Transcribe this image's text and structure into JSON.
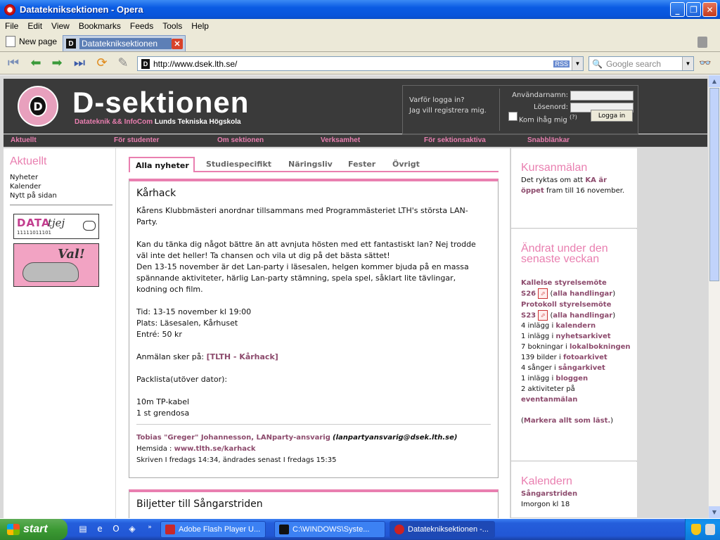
{
  "window": {
    "title": "Datateknik­sektionen - Opera"
  },
  "menubar": [
    "File",
    "Edit",
    "View",
    "Bookmarks",
    "Feeds",
    "Tools",
    "Help"
  ],
  "tabs": {
    "new_page": "New page",
    "active": "Datatekniksektionen"
  },
  "address": {
    "url": "http://www.dsek.lth.se/",
    "rss": "RSS",
    "search_placeholder": "Google search"
  },
  "header": {
    "logo_text": "D",
    "title": "D-sektionen",
    "sub_pink": "Datateknik && InfoCom",
    "sub_white": "Lunds Tekniska Högskola",
    "login": {
      "why": "Varför logga in?",
      "register": "Jag vill registrera mig.",
      "username_label": "Användarnamn:",
      "password_label": "Lösenord:",
      "remember": "Kom ihåg mig",
      "help": "(?)",
      "button": "Logga in"
    }
  },
  "topnav": [
    "Aktuellt",
    "För studenter",
    "Om sektionen",
    "Verksamhet",
    "För sektionsaktiva",
    "Snabblänkar"
  ],
  "left": {
    "title": "Aktuellt",
    "links": [
      "Nyheter",
      "Kalender",
      "Nytt på sidan"
    ],
    "banner1": {
      "data": "DATA",
      "tjej": "tjej",
      "binary": "11111011101"
    },
    "banner2": {
      "text": "Val!"
    }
  },
  "subtabs": [
    "Alla nyheter",
    "Studiespecifikt",
    "Näringsliv",
    "Fester",
    "Övrigt"
  ],
  "article1": {
    "title": "Kårhack",
    "p1": "Kårens Klubbmästeri anordnar tillsammans med Programmästeriet LTH's största LAN-Party.",
    "p2": "Kan du tänka dig något bättre än att avnjuta hösten med ett fantastiskt lan? Nej trodde väl inte det heller! Ta chansen och vila ut dig på det bästa sättet!",
    "p3": "Den 13-15 november är det Lan-party i läsesalen, helgen kommer bjuda på en massa spännande aktiviteter, härlig Lan-party stämning, spela spel, såklart lite tävlingar, kodning och film.",
    "tid": "Tid: 13-15 november kl 19:00",
    "plats": "Plats: Läsesalen, Kårhuset",
    "entre": "Entré: 50 kr",
    "anmalan_prefix": "Anmälan sker på:",
    "anmalan_link": "[TLTH - Kårhack]",
    "packlista": "Packlista(utöver dator):",
    "item1": "10m TP-kabel",
    "item2": "1 st grendosa",
    "author": "Tobias \"Greger\" Johannesson, LANparty-ansvarig",
    "email": "(lanpartyansvarig@dsek.lth.se)",
    "hemsida_label": "Hemsida :",
    "hemsida": "www.tlth.se/karhack",
    "written": "Skriven I fredags 14:34, ändrades senast I fredags 15:35"
  },
  "article2": {
    "title": "Biljetter till Sångarstriden"
  },
  "right": {
    "box1": {
      "title": "Kursanmälan",
      "t1": "Det ryktas om att",
      "link": "KA är öppet",
      "t2": "fram till 16 november."
    },
    "box2": {
      "title": "Ändrat under den senaste veckan",
      "l1": "Kallelse styrelsemöte",
      "s26": "S26",
      "alla": "alla handlingar",
      "l2": "Protokoll styrelsemöte",
      "s23": "S23",
      "r1a": "4 inlägg i",
      "r1b": "kalendern",
      "r2a": "1 inlägg i",
      "r2b": "nyhetsarkivet",
      "r3a": "7 bokningar i",
      "r3b": "lokalbokningen",
      "r4a": "139 bilder i",
      "r4b": "fotoarkivet",
      "r5a": "4 sånger i",
      "r5b": "sångarkivet",
      "r6a": "1 inlägg i",
      "r6b": "bloggen",
      "r7a": "2 aktiviteter på",
      "r7b": "eventanmälan",
      "mark": "Markera allt som läst."
    },
    "box3": {
      "title": "Kalendern",
      "event": "Sångarstriden",
      "time": "Imorgon kl 18"
    }
  },
  "taskbar": {
    "start": "start",
    "tasks": [
      "Adobe Flash Player U...",
      "C:\\WINDOWS\\Syste...",
      "Datatekniksektionen -..."
    ]
  }
}
